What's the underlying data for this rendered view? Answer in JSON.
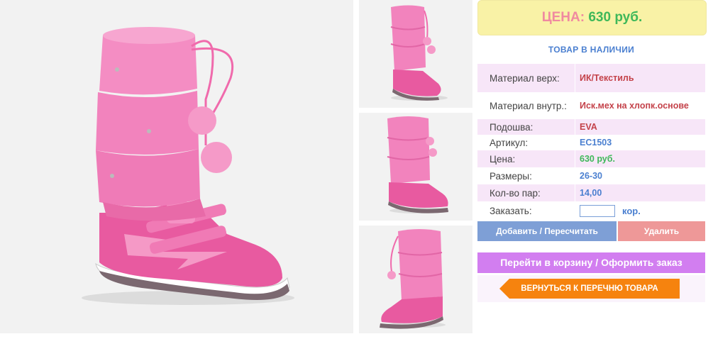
{
  "price_box": {
    "label": "ЦЕНА:",
    "value": "630 руб."
  },
  "stock_status": "ТОВАР В НАЛИЧИИ",
  "specs": [
    {
      "key": "Материал верх:",
      "value": "ИК/Текстиль"
    },
    {
      "key": "Материал внутр.:",
      "value": "Иск.мех на хлопк.основе"
    },
    {
      "key": "Подошва:",
      "value": "EVA"
    },
    {
      "key": "Артикул:",
      "value": "EC1503"
    },
    {
      "key": "Цена:",
      "value": "630 руб."
    },
    {
      "key": "Размеры:",
      "value": "26-30"
    },
    {
      "key": "Кол-во пар:",
      "value": "14,00"
    }
  ],
  "order": {
    "label": "Заказать:",
    "value": "",
    "unit": "кор."
  },
  "buttons": {
    "add": "Добавить / Пересчитать",
    "delete": "Удалить",
    "cart": "Перейти в корзину / Оформить заказ",
    "back": "ВЕРНУТЬСЯ К ПЕРЕЧНЮ ТОВАРА"
  },
  "colors": {
    "accent_pink": "#f08aa0",
    "price_green": "#3fb85a",
    "link_blue": "#4a7fd0",
    "back_orange": "#f6830e",
    "cart_purple": "#d27ef0"
  }
}
